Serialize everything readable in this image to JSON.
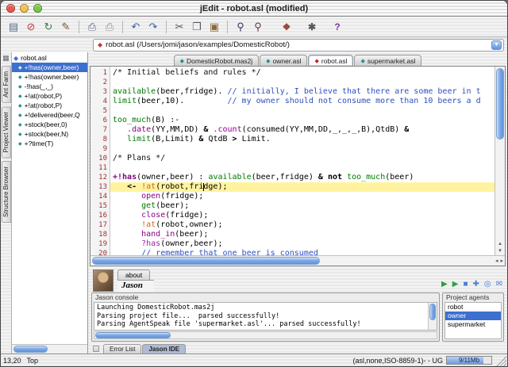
{
  "glyphs": {
    "dropdown": "▼",
    "left": "◂",
    "right": "▸",
    "up": "▴",
    "down": "▾",
    "handle": "▦",
    "diamond": "◆",
    "grid": "▦"
  },
  "window": {
    "title": "jEdit - robot.asl (modified)"
  },
  "titlebar_buttons": [
    {
      "name": "close-button",
      "color": "#e8594a"
    },
    {
      "name": "minimize-button",
      "color": "#f5bf4f"
    },
    {
      "name": "zoom-button",
      "color": "#79c943"
    }
  ],
  "toolbar": {
    "left_icons": [
      {
        "name": "new-file-icon",
        "glyph": "▤",
        "color": "#5a6a8a"
      },
      {
        "name": "close-buffer-icon",
        "glyph": "⊘",
        "color": "#c23b3b"
      },
      {
        "name": "reload-icon",
        "glyph": "↻",
        "color": "#3f7a3f"
      },
      {
        "name": "edit-macro-icon",
        "glyph": "✎",
        "color": "#7a5a2a"
      },
      {
        "sep": true
      },
      {
        "name": "print-icon",
        "glyph": "⎙",
        "color": "#55617a"
      },
      {
        "name": "page-setup-icon",
        "glyph": "⎙",
        "color": "#8a8a8a"
      },
      {
        "sep": true
      },
      {
        "name": "undo-icon",
        "glyph": "↶",
        "color": "#3a5faa"
      },
      {
        "name": "redo-icon",
        "glyph": "↷",
        "color": "#3a5faa"
      },
      {
        "sep": true
      },
      {
        "name": "cut-icon",
        "glyph": "✂",
        "color": "#555555"
      },
      {
        "name": "copy-icon",
        "glyph": "❐",
        "color": "#555566"
      },
      {
        "name": "paste-icon",
        "glyph": "▣",
        "color": "#8a6a3a"
      },
      {
        "sep": true
      },
      {
        "name": "find-icon",
        "glyph": "⚲",
        "color": "#35356a"
      },
      {
        "name": "find-next-icon",
        "glyph": "⚲",
        "color": "#6a3535"
      }
    ],
    "right_icons": [
      {
        "name": "plugin-manager-icon",
        "glyph": "❖",
        "color": "#9a4a3a"
      },
      {
        "name": "global-options-icon",
        "glyph": "✱",
        "color": "#5a5a5a"
      },
      {
        "name": "help-icon",
        "glyph": "?",
        "color": "#7a3aaa"
      }
    ]
  },
  "path_bar": {
    "icon_color": "#c23b3b",
    "value": "robot.asl (/Users/jomi/jason/examples/DomesticRobot/)"
  },
  "sidebar": {
    "vertical_tabs": [
      {
        "label": "Ant Farm"
      },
      {
        "label": "Project Viewer"
      },
      {
        "label": "Structure Browser"
      }
    ]
  },
  "tree": {
    "root": "robot.asl",
    "items": [
      {
        "label": "+!has(owner,beer)",
        "selected": true
      },
      {
        "label": "+!has(owner,beer)"
      },
      {
        "label": "-!has(_,_)"
      },
      {
        "label": "+!at(robot,P)"
      },
      {
        "label": "+!at(robot,P)"
      },
      {
        "label": "+!delivered(beer,Q"
      },
      {
        "label": "+stock(beer,0)"
      },
      {
        "label": "+stock(beer,N)"
      },
      {
        "label": "+?time(T)"
      }
    ]
  },
  "buffer_tabs": [
    {
      "label": "DomesticRobot.mas2j",
      "icon_color": "#2e8b8b"
    },
    {
      "label": "owner.asl",
      "icon_color": "#2e8b8b"
    },
    {
      "label": "robot.asl",
      "icon_color": "#cc2222",
      "active": true
    },
    {
      "label": "supermarket.asl",
      "icon_color": "#2e8b8b"
    }
  ],
  "editor": {
    "lines": [
      {
        "n": 1,
        "segs": [
          [
            "/* Initial beliefs and rules */",
            "c2"
          ]
        ]
      },
      {
        "n": 2,
        "segs": []
      },
      {
        "n": 3,
        "segs": [
          [
            "available",
            "gr"
          ],
          [
            "(beer,fridge). ",
            "pl"
          ],
          [
            "// initially, I believe that there are some beer in t",
            "c1"
          ]
        ]
      },
      {
        "n": 4,
        "segs": [
          [
            "limit",
            "gr"
          ],
          [
            "(beer,10).         ",
            "pl"
          ],
          [
            "// my owner should not consume more than 10 beers a d",
            "c1"
          ]
        ]
      },
      {
        "n": 5,
        "segs": []
      },
      {
        "n": 6,
        "segs": [
          [
            "too_much",
            "gr"
          ],
          [
            "(B) :-",
            "pl"
          ]
        ]
      },
      {
        "n": 7,
        "segs": [
          [
            "   ",
            "pl"
          ],
          [
            ".date",
            "ia"
          ],
          [
            "(YY,MM,DD) ",
            "pl"
          ],
          [
            "&",
            "b"
          ],
          [
            " ",
            "pl"
          ],
          [
            ".count",
            "ia"
          ],
          [
            "(consumed(YY,MM,DD,_,_,_,B),QtdB) ",
            "pl"
          ],
          [
            "&",
            "b"
          ]
        ]
      },
      {
        "n": 8,
        "segs": [
          [
            "   ",
            "pl"
          ],
          [
            "limit",
            "gr"
          ],
          [
            "(B,Limit) ",
            "pl"
          ],
          [
            "&",
            "b"
          ],
          [
            " QtdB ",
            "pl"
          ],
          [
            ">",
            "b"
          ],
          [
            " Limit.",
            "pl"
          ]
        ]
      },
      {
        "n": 9,
        "segs": []
      },
      {
        "n": 10,
        "segs": [
          [
            "/* Plans */",
            "c2"
          ]
        ]
      },
      {
        "n": 11,
        "segs": []
      },
      {
        "n": 12,
        "segs": [
          [
            "+!has",
            "gl"
          ],
          [
            "(owner,beer) : ",
            "pl"
          ],
          [
            "available",
            "gr"
          ],
          [
            "(beer,fridge) ",
            "pl"
          ],
          [
            "&",
            "b"
          ],
          [
            " ",
            "pl"
          ],
          [
            "not",
            "b"
          ],
          [
            " ",
            "pl"
          ],
          [
            "too_much",
            "gr"
          ],
          [
            "(beer)",
            "pl"
          ]
        ]
      },
      {
        "n": 13,
        "current": true,
        "segs": [
          [
            "   ",
            "pl"
          ],
          [
            "<- ",
            "b"
          ],
          [
            "!at",
            "or"
          ],
          [
            "(robot,fridge);",
            "pl"
          ]
        ]
      },
      {
        "n": 14,
        "segs": [
          [
            "      ",
            "pl"
          ],
          [
            "open",
            "pu"
          ],
          [
            "(fridge);",
            "pl"
          ]
        ]
      },
      {
        "n": 15,
        "segs": [
          [
            "      ",
            "pl"
          ],
          [
            "get",
            "gr"
          ],
          [
            "(beer);",
            "pl"
          ]
        ]
      },
      {
        "n": 16,
        "segs": [
          [
            "      ",
            "pl"
          ],
          [
            "close",
            "pu"
          ],
          [
            "(fridge);",
            "pl"
          ]
        ]
      },
      {
        "n": 17,
        "segs": [
          [
            "      ",
            "pl"
          ],
          [
            "!at",
            "or"
          ],
          [
            "(robot,owner);",
            "pl"
          ]
        ]
      },
      {
        "n": 18,
        "segs": [
          [
            "      ",
            "pl"
          ],
          [
            "hand_in",
            "pu"
          ],
          [
            "(beer);",
            "pl"
          ]
        ]
      },
      {
        "n": 19,
        "segs": [
          [
            "      ",
            "pl"
          ],
          [
            "?has",
            "ma"
          ],
          [
            "(owner,beer);",
            "pl"
          ]
        ]
      },
      {
        "n": 20,
        "segs": [
          [
            "      ",
            "pl"
          ],
          [
            "// remember that one beer is consumed",
            "c1"
          ]
        ]
      }
    ]
  },
  "about": {
    "tab": "about",
    "name": "Jason",
    "icons": [
      {
        "name": "run-mas-icon",
        "glyph": "▶",
        "color": "#2f9e44"
      },
      {
        "name": "debug-mas-icon",
        "glyph": "▶",
        "color": "#2f9e44"
      },
      {
        "name": "stop-mas-icon",
        "glyph": "■",
        "color": "#4a7fd4"
      },
      {
        "name": "new-agent-icon",
        "glyph": "✚",
        "color": "#4a7fd4"
      },
      {
        "name": "mind-inspector-icon",
        "glyph": "◎",
        "color": "#4a7fd4"
      },
      {
        "name": "jason-help-icon",
        "glyph": "✉",
        "color": "#4a7fd4"
      }
    ]
  },
  "console": {
    "title": "Jason console",
    "lines": [
      "Launching DomesticRobot.mas2j",
      "Parsing project file...  parsed successfully!",
      "Parsing AgentSpeak file 'supermarket.asl'... parsed successfully!"
    ]
  },
  "agents": {
    "title": "Project agents",
    "items": [
      {
        "label": "robot"
      },
      {
        "label": "owner",
        "selected": true
      },
      {
        "label": "supermarket"
      }
    ]
  },
  "bottom_tabs": [
    {
      "label": "Error List"
    },
    {
      "label": "Jason IDE",
      "active": true
    }
  ],
  "status": {
    "caret": "13,20",
    "scroll": "Top",
    "mode_info": "(asl,none,ISO-8859-1)- - UG",
    "memory": "9/11Mb",
    "memory_fill": 0.82
  }
}
